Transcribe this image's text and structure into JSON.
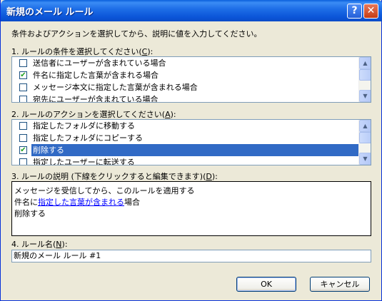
{
  "window": {
    "title": "新規のメール ルール"
  },
  "titlebar": {
    "help_glyph": "?",
    "close_glyph": "✕"
  },
  "intro_text": "条件およびアクションを選択してから、説明に値を入力してください。",
  "step1": {
    "label_pre": "1. ルールの条件を選択してください(",
    "label_key": "C",
    "label_post": "):",
    "items": [
      {
        "text": "送信者にユーザーが含まれている場合",
        "checked": false
      },
      {
        "text": "件名に指定した言葉が含まれる場合",
        "checked": true
      },
      {
        "text": "メッセージ本文に指定した言葉が含まれる場合",
        "checked": false
      },
      {
        "text": "宛先にユーザーが含まれている場合",
        "checked": false
      }
    ]
  },
  "step2": {
    "label_pre": "2. ルールのアクションを選択してください(",
    "label_key": "A",
    "label_post": "):",
    "items": [
      {
        "text": "指定したフォルダに移動する",
        "checked": false
      },
      {
        "text": "指定したフォルダにコピーする",
        "checked": false
      },
      {
        "text": "削除する",
        "checked": true,
        "selected": true
      },
      {
        "text": "指定したユーザーに転送する",
        "checked": false
      }
    ]
  },
  "step3": {
    "label_pre": "3. ルールの説明 (下線をクリックすると編集できます)(",
    "label_key": "D",
    "label_post": "):",
    "line1": "メッセージを受信してから、このルールを適用する",
    "line2_pre": "件名に",
    "line2_link": "指定した言葉が含まれる",
    "line2_post": "場合",
    "line3": "削除する"
  },
  "step4": {
    "label_pre": "4. ルール名(",
    "label_key": "N",
    "label_post": "):",
    "value": "新規のメール ルール #1"
  },
  "buttons": {
    "ok": "OK",
    "cancel": "キャンセル"
  },
  "check_glyph": "✔",
  "scroll": {
    "up_glyph": "▲",
    "down_glyph": "▼"
  },
  "colors": {
    "selection": "#316ac5",
    "titlebar": "#0a5fdc",
    "link": "#0000ff"
  }
}
